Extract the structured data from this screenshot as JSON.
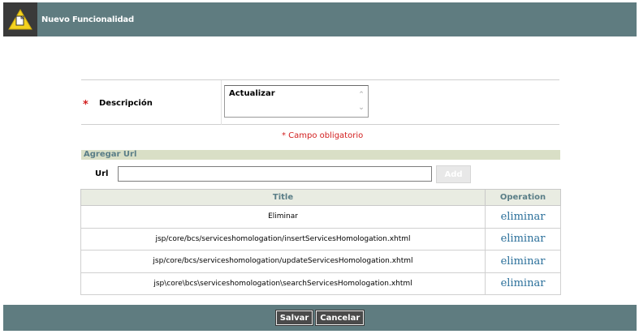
{
  "header": {
    "title": "Nuevo Funcionalidad",
    "icon": "warning-document-icon"
  },
  "form": {
    "descripcion_label": "Descripción",
    "descripcion_value": "Actualizar",
    "required_marker": "*",
    "required_note": "* Campo obligatorio"
  },
  "url_section": {
    "title": "Agregar Url",
    "url_label": "Url",
    "url_value": "",
    "add_label": "Add"
  },
  "table": {
    "columns": [
      "Title",
      "Operation"
    ],
    "rows": [
      {
        "title": "Eliminar",
        "operation": "eliminar"
      },
      {
        "title": "jsp/core/bcs/serviceshomologation/insertServicesHomologation.xhtml",
        "operation": "eliminar"
      },
      {
        "title": "jsp/core/bcs/serviceshomologation/updateServicesHomologation.xhtml",
        "operation": "eliminar"
      },
      {
        "title": "jsp\\core\\bcs\\serviceshomologation\\searchServicesHomologation.xhtml",
        "operation": "eliminar"
      }
    ]
  },
  "footer": {
    "save_label": "Salvar",
    "cancel_label": "Cancelar"
  },
  "colors": {
    "header_bg": "#5f7c80",
    "required": "#d21e1e",
    "link": "#2a6f9a",
    "section_bg": "#d9dfc6"
  }
}
